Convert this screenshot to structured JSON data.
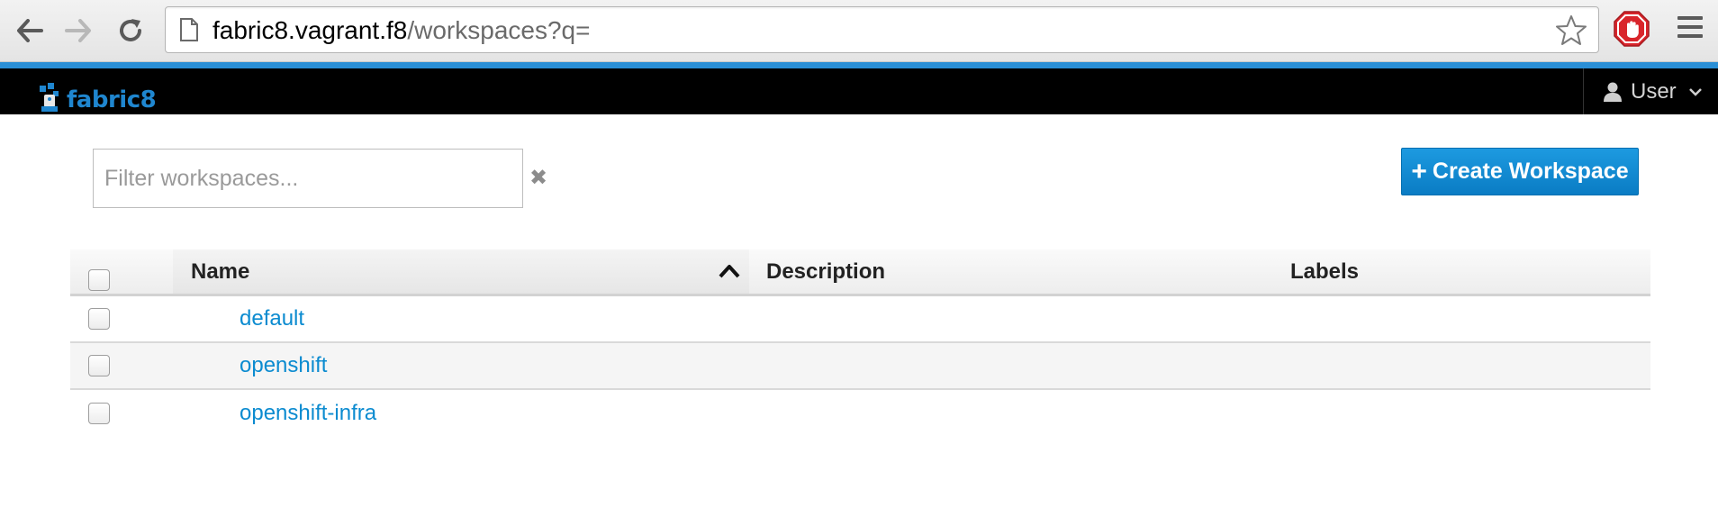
{
  "browser": {
    "url_host": "fabric8.vagrant.f8",
    "url_path": "/workspaces?q=",
    "icons": {
      "back": "back-arrow-icon",
      "forward": "forward-arrow-icon",
      "reload": "reload-icon",
      "page": "page-icon",
      "bookmark": "star-icon",
      "extension": "adblock-icon",
      "menu": "hamburger-menu-icon"
    },
    "accent_color": "#2a8fd6"
  },
  "header": {
    "brand_name": "fabric8",
    "user_label": "User",
    "brand_color": "#1f86cf"
  },
  "toolbar": {
    "filter_placeholder": "Filter workspaces...",
    "create_button_plus": "+",
    "create_button_label": "Create Workspace",
    "button_color": "#0a8ad4"
  },
  "table": {
    "columns": [
      "Name",
      "Description",
      "Labels"
    ],
    "sort_column": "Name",
    "sort_direction": "ascending",
    "rows": [
      {
        "name": "default",
        "description": "",
        "labels": ""
      },
      {
        "name": "openshift",
        "description": "",
        "labels": ""
      },
      {
        "name": "openshift-infra",
        "description": "",
        "labels": ""
      }
    ],
    "link_color": "#0b8bd0"
  }
}
